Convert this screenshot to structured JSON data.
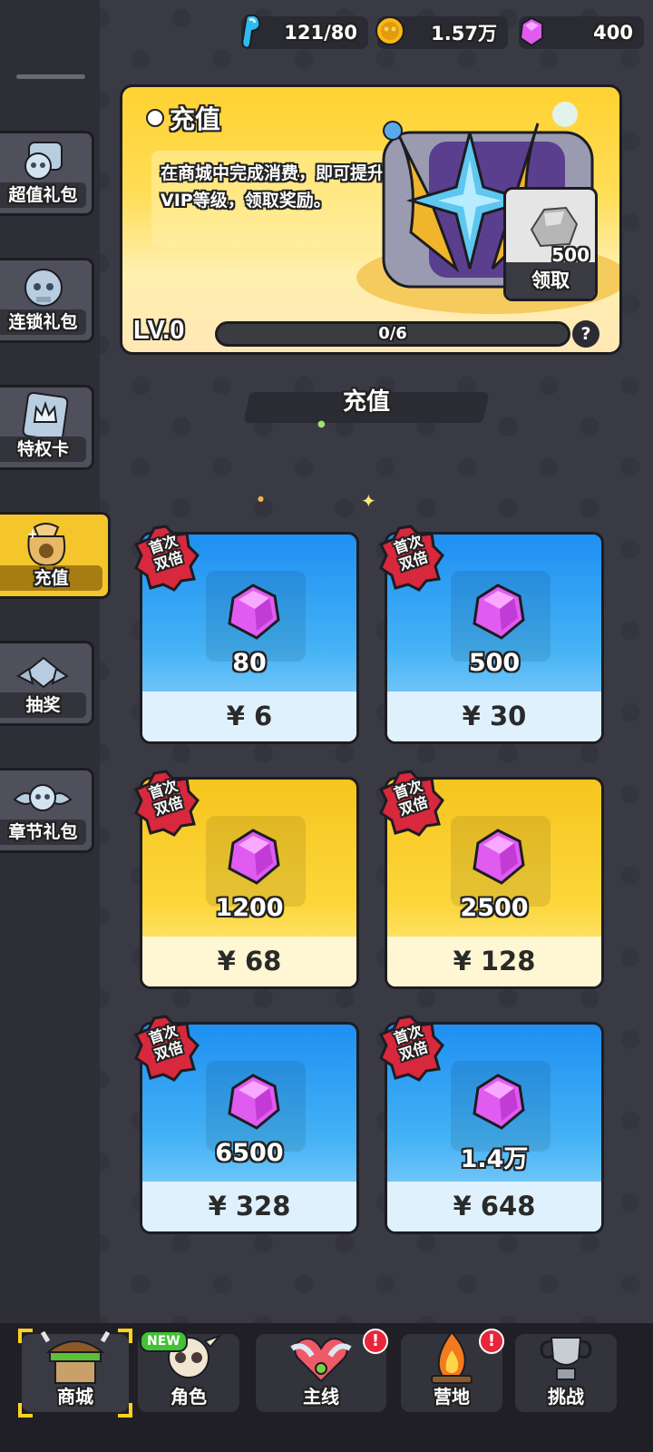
{
  "currencies": {
    "stamina": "121/80",
    "coins": "1.57万",
    "gems": "400"
  },
  "sidebar": {
    "items": [
      {
        "label": "超值礼包",
        "icon": "skull-gift-icon"
      },
      {
        "label": "连锁礼包",
        "icon": "chain-skull-icon"
      },
      {
        "label": "特权卡",
        "icon": "crown-card-icon"
      },
      {
        "label": "充值",
        "icon": "coin-bag-icon"
      },
      {
        "label": "抽奖",
        "icon": "lottery-chest-icon"
      },
      {
        "label": "章节礼包",
        "icon": "winged-skull-icon"
      }
    ],
    "active_index": 3
  },
  "banner": {
    "title": "充值",
    "description": "在商城中完成消费，即可提升VIP等级，领取奖励。",
    "reward_amount": "500",
    "claim_label": "领取",
    "level_label": "LV.0",
    "progress_text": "0/6",
    "progress_value": 0,
    "help_label": "?"
  },
  "section": {
    "title": "充值"
  },
  "products": [
    {
      "amount": "80",
      "price": "¥ 6",
      "badge": "首次双倍",
      "theme": "blue"
    },
    {
      "amount": "500",
      "price": "¥ 30",
      "badge": "首次双倍",
      "theme": "blue"
    },
    {
      "amount": "1200",
      "price": "¥ 68",
      "badge": "首次双倍",
      "theme": "gold"
    },
    {
      "amount": "2500",
      "price": "¥ 128",
      "badge": "首次双倍",
      "theme": "gold"
    },
    {
      "amount": "6500",
      "price": "¥ 328",
      "badge": "首次双倍",
      "theme": "blue"
    },
    {
      "amount": "1.4万",
      "price": "¥ 648",
      "badge": "首次双倍",
      "theme": "blue"
    }
  ],
  "bottom_nav": {
    "items": [
      {
        "label": "商城",
        "icon": "shop-icon"
      },
      {
        "label": "角色",
        "icon": "skull-character-icon",
        "tag": "NEW"
      },
      {
        "label": "主线",
        "icon": "heart-wings-icon",
        "alert": "!"
      },
      {
        "label": "营地",
        "icon": "campfire-icon",
        "alert": "!"
      },
      {
        "label": "挑战",
        "icon": "trophy-icon"
      }
    ],
    "active_index": 0
  },
  "colors": {
    "background": "#3a3a45",
    "gold": "#f5c62b",
    "gem_pink": "#e05bf0",
    "card_blue": "#1f8ff2",
    "alert_red": "#e8263b"
  }
}
